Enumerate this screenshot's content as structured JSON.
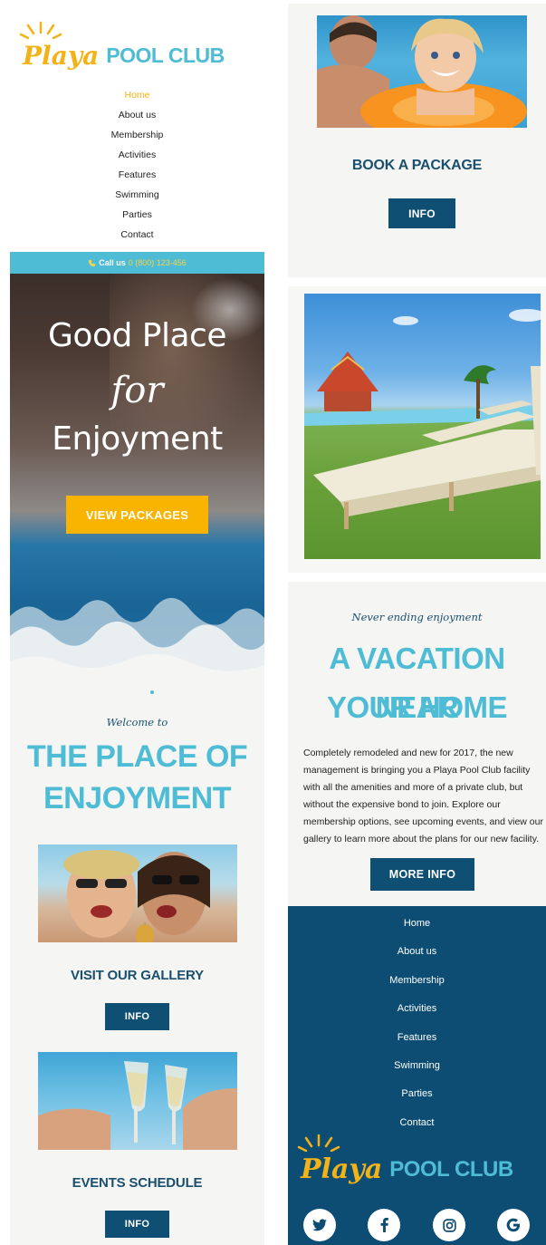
{
  "brand": {
    "word1": "Playa",
    "word2": "POOL CLUB"
  },
  "nav": {
    "items": [
      "Home",
      "About us",
      "Membership",
      "Activities",
      "Features",
      "Swimming",
      "Parties",
      "Contact"
    ],
    "active": "Home"
  },
  "callbar": {
    "label": "Call us",
    "phone": "0 (800) 123-456"
  },
  "hero": {
    "line1": "Good Place",
    "line2": "for",
    "line3": "Enjoyment",
    "button": "VIEW PACKAGES"
  },
  "welcome": {
    "script": "Welcome to",
    "title_line1": "THE PLACE OF",
    "title_line2": "ENJOYMENT",
    "gallery_title": "VISIT OUR GALLERY",
    "gallery_button": "INFO",
    "events_title": "EVENTS SCHEDULE",
    "events_button": "INFO"
  },
  "package": {
    "title": "BOOK A PACKAGE",
    "button": "INFO"
  },
  "vacation": {
    "script": "Never ending enjoyment",
    "title_line1": "A VACATION NEAR",
    "title_line2": "YOUR HOME",
    "paragraph": "Completely remodeled and new for 2017, the new management is bringing you a Playa Pool Club facility with all the amenities and more of a private club, but without the expensive bond to join. Explore our membership options, see upcoming events, and view our gallery to learn more about the plans for our new facility.",
    "button": "MORE INFO"
  },
  "footer": {
    "items": [
      "Home",
      "About us",
      "Membership",
      "Activities",
      "Features",
      "Swimming",
      "Parties",
      "Contact"
    ],
    "social": [
      "twitter-icon",
      "facebook-icon",
      "instagram-icon",
      "google-icon"
    ]
  },
  "colors": {
    "accent_blue": "#4dbcd4",
    "accent_yellow": "#f3b317",
    "navy": "#0f4f74"
  }
}
